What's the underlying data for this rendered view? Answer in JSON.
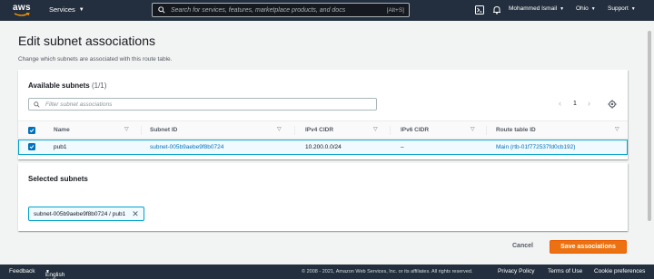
{
  "nav": {
    "logo": "aws",
    "services_label": "Services",
    "search_placeholder": "Search for services, features, marketplace products, and docs",
    "search_shortcut": "[Alt+S]",
    "user": "Mohammed Ismail",
    "region": "Ohio",
    "support": "Support"
  },
  "page": {
    "title": "Edit subnet associations",
    "description": "Change which subnets are associated with this route table."
  },
  "available": {
    "heading": "Available subnets",
    "count": "(1/1)",
    "filter_placeholder": "Filter subnet associations",
    "page_number": "1",
    "columns": [
      "Name",
      "Subnet ID",
      "IPv4 CIDR",
      "IPv6 CIDR",
      "Route table ID"
    ],
    "rows": [
      {
        "name": "pub1",
        "subnet_id": "subnet-005b9aebe9f8b0724",
        "ipv4": "10.200.0.0/24",
        "ipv6": "–",
        "route_table": "Main (rtb-01f772537fd0cb192)",
        "selected": true
      }
    ]
  },
  "selected": {
    "heading": "Selected subnets",
    "token": "subnet-005b9aebe9f8b0724 / pub1"
  },
  "actions": {
    "cancel": "Cancel",
    "save": "Save associations"
  },
  "footer": {
    "feedback": "Feedback",
    "language": "English (US)",
    "copyright": "© 2008 - 2021, Amazon Web Services, Inc. or its affiliates. All rights reserved.",
    "privacy": "Privacy Policy",
    "terms": "Terms of Use",
    "cookies": "Cookie preferences"
  },
  "colors": {
    "nav_bg": "#232f3e",
    "accent_orange": "#ec7211",
    "link_blue": "#0073bb",
    "selection_border": "#00a1c9"
  }
}
